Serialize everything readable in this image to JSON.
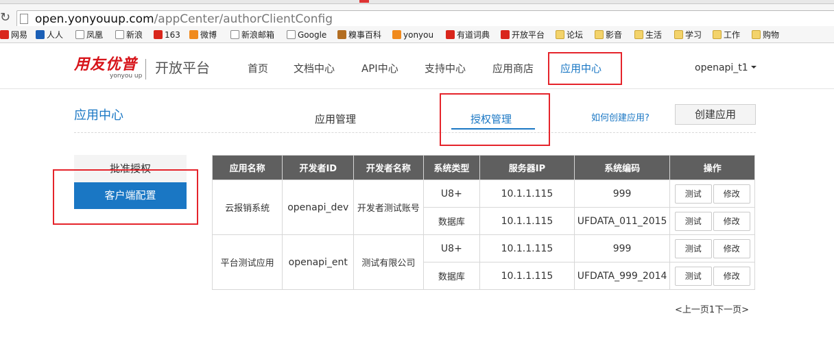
{
  "browser": {
    "url_host": "open.yonyouup.com",
    "url_path": "/appCenter/authorClientConfig",
    "reload_icon": "reload-icon"
  },
  "bookmarks": [
    {
      "label": "网易",
      "icon": "bookmark-icon"
    },
    {
      "label": "人人",
      "icon": "bookmark-icon"
    },
    {
      "label": "凤凰",
      "icon": "page-icon"
    },
    {
      "label": "新浪",
      "icon": "page-icon"
    },
    {
      "label": "163",
      "icon": "bookmark-icon"
    },
    {
      "label": "微博",
      "icon": "bookmark-icon"
    },
    {
      "label": "新浪邮箱",
      "icon": "page-icon"
    },
    {
      "label": "Google",
      "icon": "page-icon"
    },
    {
      "label": "糗事百科",
      "icon": "bookmark-icon"
    },
    {
      "label": "yonyou",
      "icon": "bookmark-icon"
    },
    {
      "label": "有道词典",
      "icon": "bookmark-icon"
    },
    {
      "label": "开放平台",
      "icon": "bookmark-icon"
    },
    {
      "label": "论坛",
      "icon": "folder-icon"
    },
    {
      "label": "影音",
      "icon": "folder-icon"
    },
    {
      "label": "生活",
      "icon": "folder-icon"
    },
    {
      "label": "学习",
      "icon": "folder-icon"
    },
    {
      "label": "工作",
      "icon": "folder-icon"
    },
    {
      "label": "购物",
      "icon": "folder-icon"
    }
  ],
  "header": {
    "logo_cn": "用友优普",
    "logo_en": "yonyou up",
    "platform": "开放平台",
    "nav": [
      "首页",
      "文档中心",
      "API中心",
      "支持中心",
      "应用商店",
      "应用中心"
    ],
    "active_nav": "应用中心",
    "user": "openapi_t1"
  },
  "subheader": {
    "title": "应用中心",
    "tabs": [
      "应用管理",
      "授权管理"
    ],
    "active_tab": "授权管理",
    "help_link": "如何创建应用?",
    "create_button": "创建应用"
  },
  "sidebar": {
    "items": [
      "批准授权",
      "客户端配置"
    ],
    "active": "客户端配置"
  },
  "table": {
    "headers": [
      "应用名称",
      "开发者ID",
      "开发者名称",
      "系统类型",
      "服务器IP",
      "系统编码",
      "操作"
    ],
    "apps": [
      {
        "name": "云报销系统",
        "dev_id": "openapi_dev",
        "dev_name": "开发者测试账号",
        "rows": [
          {
            "type": "U8+",
            "ip": "10.1.1.115",
            "code": "999"
          },
          {
            "type": "数据库",
            "ip": "10.1.1.115",
            "code": "UFDATA_011_2015"
          }
        ]
      },
      {
        "name": "平台测试应用",
        "dev_id": "openapi_ent",
        "dev_name": "测试有限公司",
        "rows": [
          {
            "type": "U8+",
            "ip": "10.1.1.115",
            "code": "999"
          },
          {
            "type": "数据库",
            "ip": "10.1.1.115",
            "code": "UFDATA_999_2014"
          }
        ]
      }
    ],
    "actions": {
      "test": "测试",
      "edit": "修改"
    }
  },
  "pager": "<上一页1下一页>",
  "colors": {
    "accent": "#1a77c4",
    "annotation": "#e5232a",
    "table_header": "#5f5f5f"
  }
}
